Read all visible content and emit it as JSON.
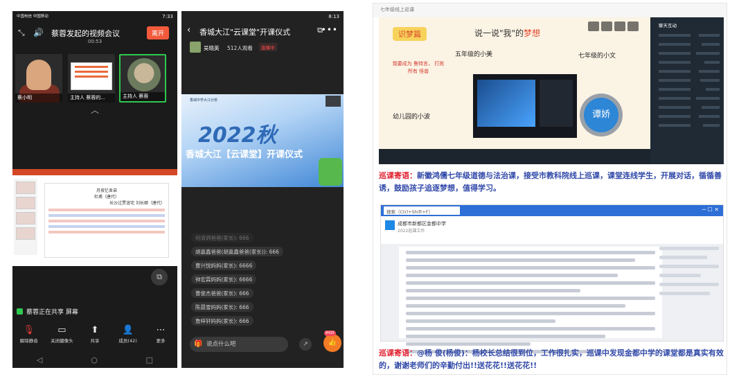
{
  "panel1": {
    "status_left": "中国电信 中国移动",
    "status_right": "7:33",
    "meeting_title": "蔡蓉发起的视频会议",
    "timer": "00:53",
    "leave_label": "离开",
    "thumbs": [
      {
        "label": "蔡小明"
      },
      {
        "label": "主持人 蔡蓉的..."
      },
      {
        "label": "主持人 蔡蓉"
      }
    ],
    "slide_title": "月夜忆舍弟",
    "slide_subtitle": "杜甫（唐代）",
    "slide_right_title": "长沙过贾谊宅 刘长卿（唐代）",
    "sharing_text": "蔡蓉正在共享 屏幕",
    "toolbar": [
      {
        "icon": "mic-off-icon",
        "label": "解除静音"
      },
      {
        "icon": "camera-icon",
        "label": "关闭摄像头"
      },
      {
        "icon": "share-icon",
        "label": "共享"
      },
      {
        "icon": "members-icon",
        "label": "成员(42)"
      },
      {
        "icon": "more-icon",
        "label": "更多"
      }
    ]
  },
  "panel2": {
    "status_right": "8:13",
    "title": "香城大江\"云课堂\"开课仪式",
    "host_name": "吴晓英",
    "viewers": "512人观看",
    "live_tag": "直播中",
    "video_school": "香城中学大江分校",
    "video_year": "2022秋",
    "video_caption": "香城大江【云课堂】开课仪式",
    "comments": [
      "何清洞爸爸(家长): 666",
      "胡嘉鑫爸爸(胡嘉鑫爸爸(家长)): 666",
      "曹兴悦妈妈(家长): 6666",
      "钟宏霖妈妈(家长): 6666",
      "曹俊杰爸爸(家长): 666",
      "陈晨雪妈妈(家长): 666",
      "詹梓轩妈妈(家长): 666"
    ],
    "input_placeholder": "说点什么吧",
    "like_count": "8435"
  },
  "panel3": {
    "window_title": "七年级线上巡课",
    "slide_ribbon": "识梦篇",
    "slide_heading_prefix": "说一说\"我\"的",
    "slide_heading_word": "梦想",
    "grade5": "五年级的小美",
    "grade7": "七年级的小文",
    "kindergarten": "幼儿园的小波",
    "dream_text": "我要成为 鲁特言， 打败所有 怪兽",
    "avatar_name": "谭娇",
    "side_title": "聊天互动",
    "caption1_label": "巡课寄语：",
    "caption1_text": "新徽鸿儒七年级道德与法治课，接受市教科院线上巡课，课堂连线学生，开展对话，循循善诱，鼓励孩子追逐梦想，值得学习。",
    "doc_tab": "搜索（Ctrl+Shift+F）",
    "doc_school": "成都市新都区金都中学",
    "doc_sub": "2022巡课工作",
    "caption2_label": "巡课寄语：",
    "caption2_text": "@杨 俊(杨俊)：杨校长总结很到位，工作很扎实，巡课中发现金都中学的课堂都是真实有效的，谢谢老师们的辛勤付出!!送花花!!送花花!!"
  }
}
